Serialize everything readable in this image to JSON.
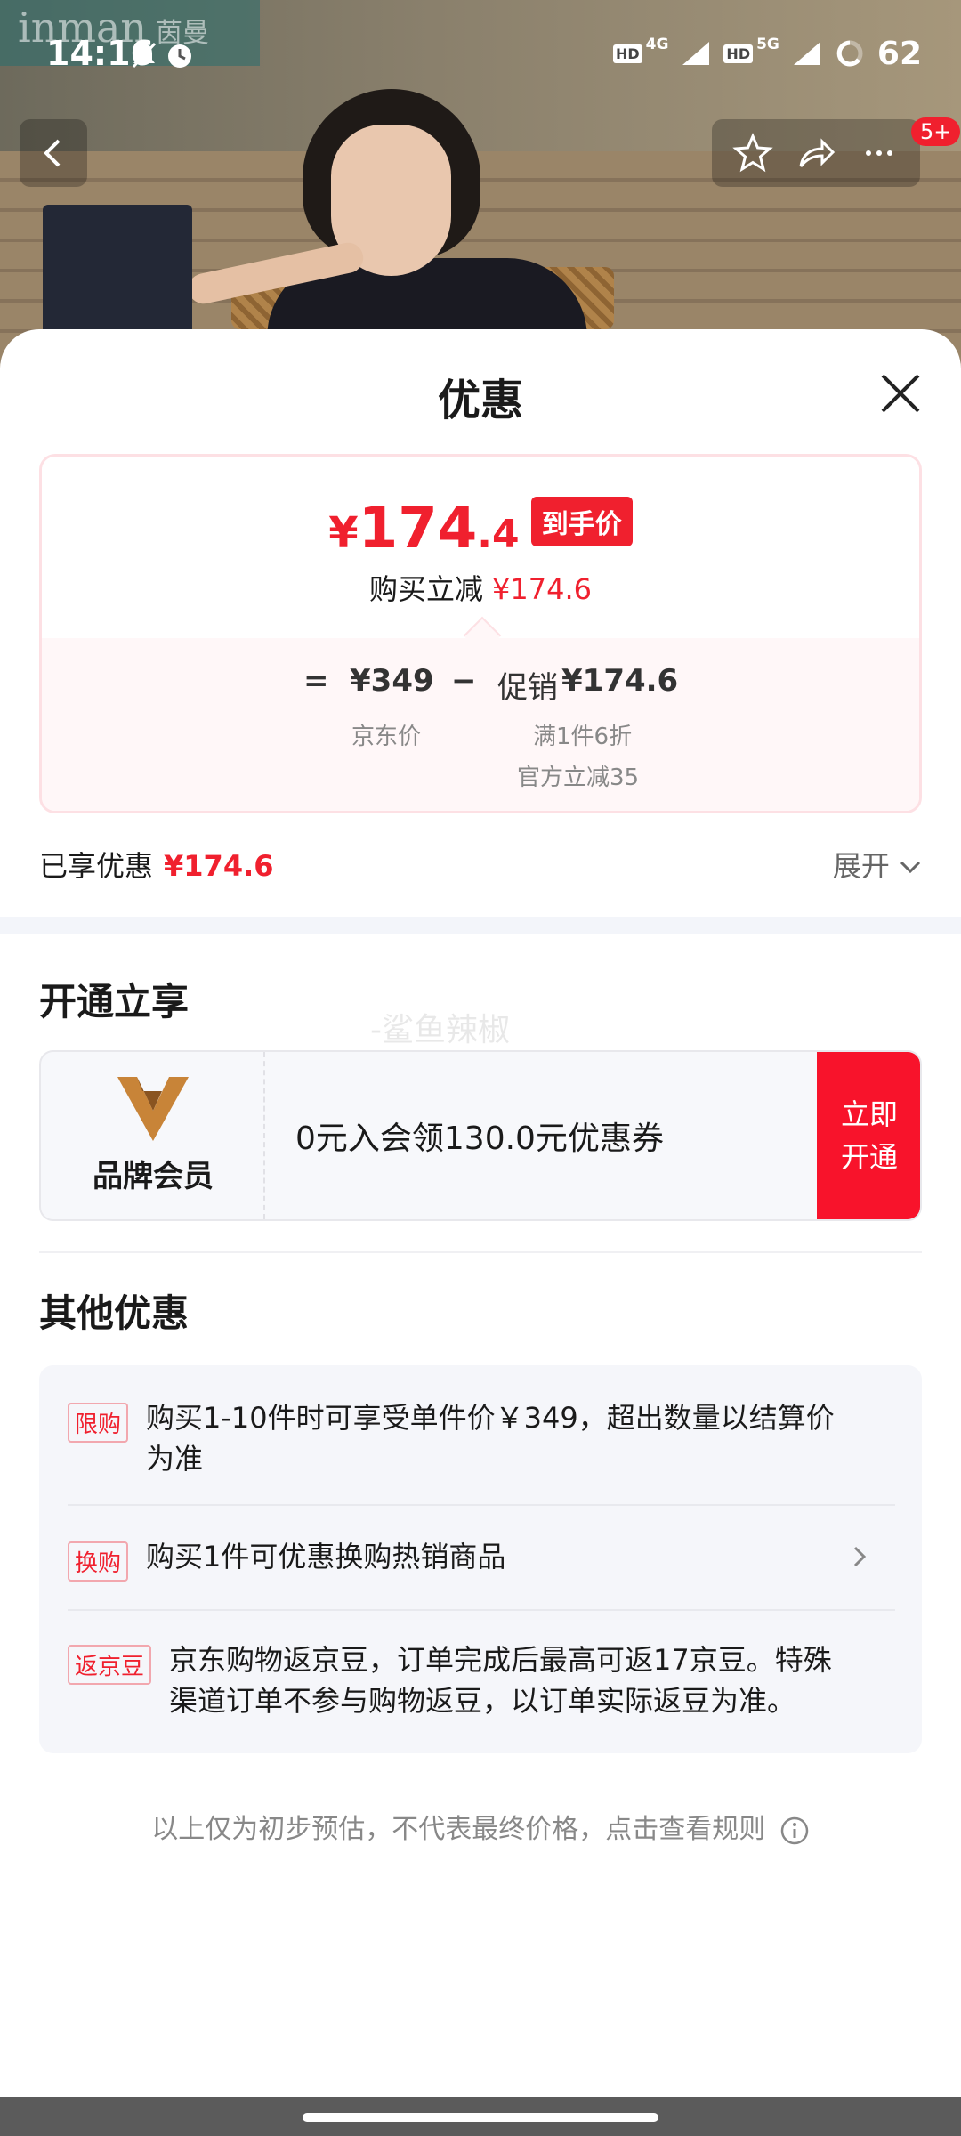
{
  "status_bar": {
    "time": "14:16",
    "network_1": "4G",
    "network_2": "5G",
    "hd": "HD",
    "battery": "62"
  },
  "brand_logo": {
    "text": "inman",
    "sub": "茵曼"
  },
  "nav": {
    "badge": "5+"
  },
  "sheet": {
    "title": "优惠",
    "price": {
      "yen": "¥",
      "integer": "174",
      "decimal": ".4",
      "tag": "到手价",
      "sub_label": "购买立减",
      "sub_value": "¥174.6"
    },
    "breakdown": {
      "equals": "=",
      "jd_price": "¥349",
      "jd_price_label": "京东价",
      "minus": "−",
      "promo_label": "促销",
      "promo_value": "¥174.6",
      "promo_detail_1": "满1件6折",
      "promo_detail_2": "官方立减35"
    },
    "enjoyed": {
      "label": "已享优惠",
      "value": "¥174.6"
    },
    "expand_label": "展开",
    "open_section": {
      "title": "开通立享",
      "watermark": "-鲨鱼辣椒",
      "member_label": "品牌会员",
      "offer_text": "0元入会领130.0元优惠券",
      "button_line_1": "立即",
      "button_line_2": "开通"
    },
    "other_section": {
      "title": "其他优惠",
      "items": [
        {
          "tag": "限购",
          "text_line_1": "购买1-10件时可享受单件价￥349，超出数量以结算价",
          "text_line_2": "为准"
        },
        {
          "tag": "换购",
          "text_line_1": "购买1件可优惠换购热销商品"
        },
        {
          "tag": "返京豆",
          "text_line_1": "京东购物返京豆，订单完成后最高可返17京豆。特殊",
          "text_line_2": "渠道订单不参与购物返豆，以订单实际返豆为准。"
        }
      ]
    },
    "footnote": "以上仅为初步预估，不代表最终价格，点击查看规则"
  },
  "colors": {
    "accent_red": "#f0202e",
    "button_red": "#f8132b"
  }
}
